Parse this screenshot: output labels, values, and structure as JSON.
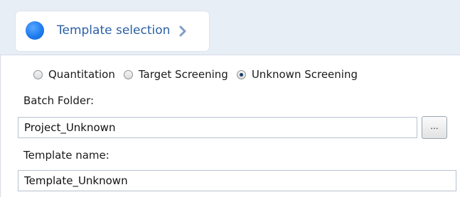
{
  "header": {
    "step_label": "Template selection",
    "step_status_color": "#1f7cf0"
  },
  "screening_mode": {
    "options": [
      {
        "label": "Quantitation",
        "selected": false
      },
      {
        "label": "Target Screening",
        "selected": false
      },
      {
        "label": "Unknown Screening",
        "selected": true
      }
    ]
  },
  "batch_folder": {
    "label": "Batch Folder:",
    "value": "Project_Unknown",
    "browse_label": "..."
  },
  "template_name": {
    "label": "Template name:",
    "value": "Template_Unknown"
  }
}
